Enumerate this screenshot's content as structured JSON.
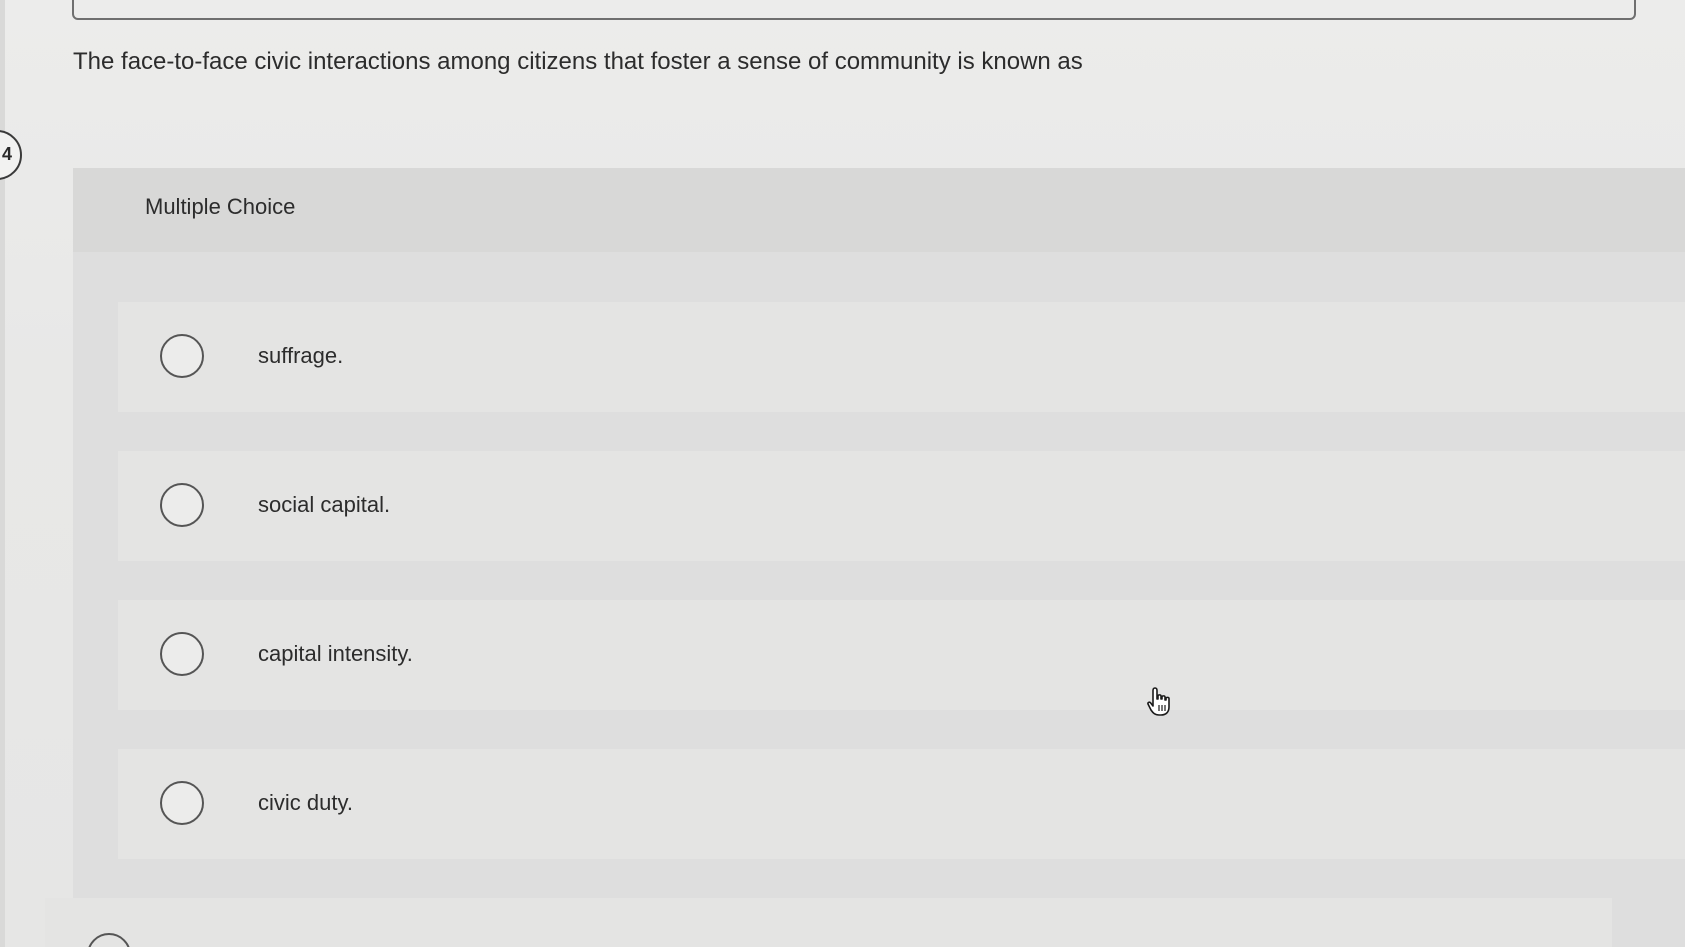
{
  "question": {
    "number": "4",
    "text": "The face-to-face civic interactions among citizens that foster a sense of community is known as"
  },
  "multiple_choice": {
    "label": "Multiple Choice",
    "options": [
      {
        "label": "suffrage."
      },
      {
        "label": "social capital."
      },
      {
        "label": "capital intensity."
      },
      {
        "label": "civic duty."
      }
    ]
  },
  "icons": {
    "cursor": "hand-pointer-icon",
    "radio": "radio-circle-icon"
  }
}
